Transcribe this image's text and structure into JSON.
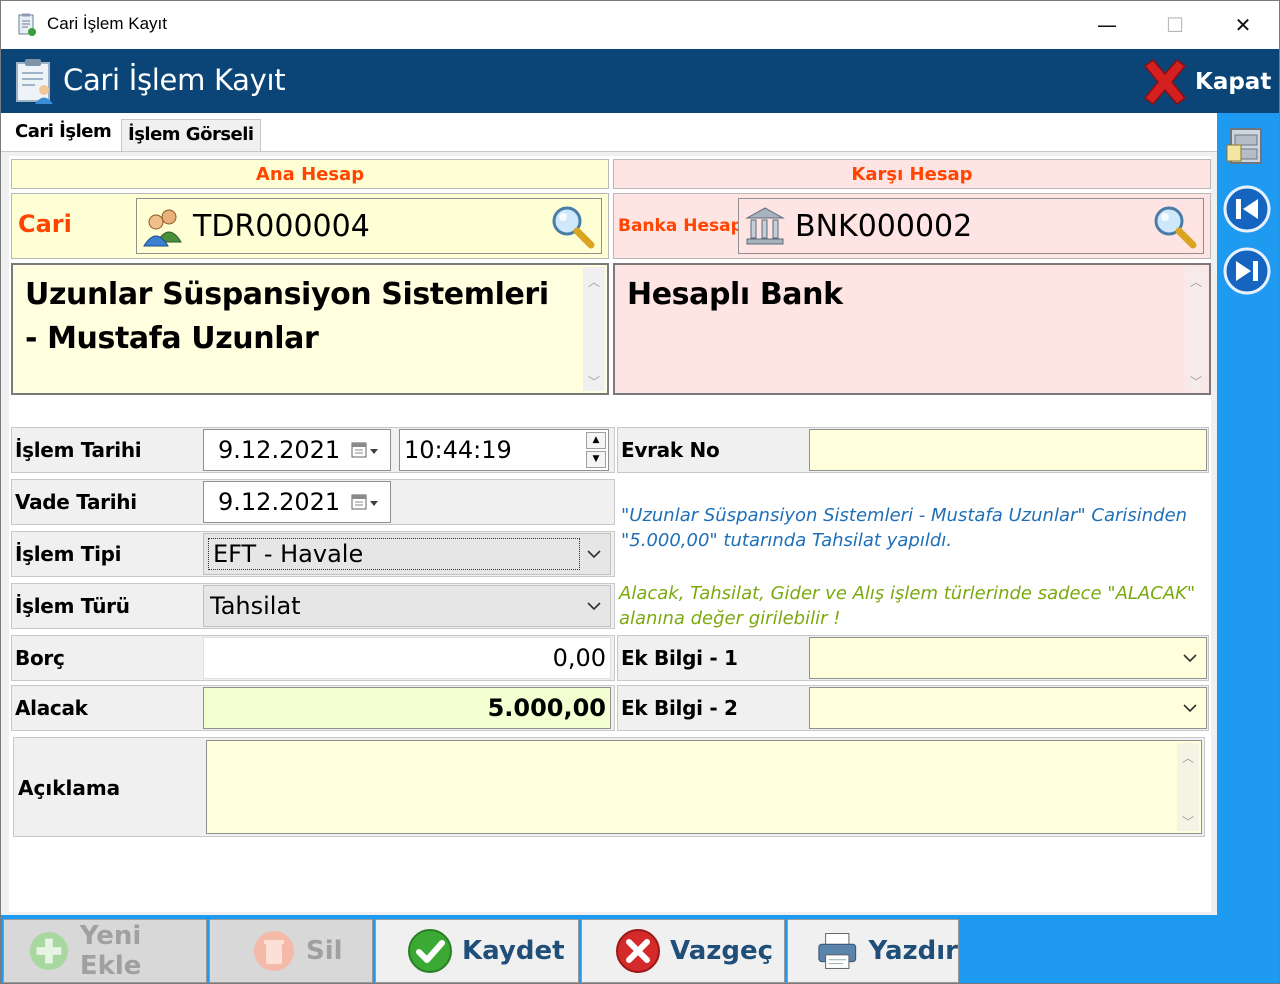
{
  "window": {
    "title": "Cari İşlem Kayıt",
    "controls": {
      "minimize": "—",
      "maximize": "☐",
      "close": "✕"
    }
  },
  "header": {
    "title": "Cari İşlem Kayıt",
    "close_label": "Kapat"
  },
  "tabs": [
    {
      "label": "Cari İşlem",
      "active": true
    },
    {
      "label": "İşlem Görseli",
      "active": false
    }
  ],
  "ana_hesap": {
    "heading": "Ana Hesap",
    "type_label": "Cari",
    "code": "TDR000004",
    "description": "Uzunlar Süspansiyon Sistemleri - Mustafa Uzunlar"
  },
  "karsi_hesap": {
    "heading": "Karşı Hesap",
    "type_label": "Banka Hesap",
    "code": "BNK000002",
    "description": "Hesaplı Bank"
  },
  "form": {
    "islem_tarihi_label": "İşlem Tarihi",
    "islem_tarihi": "9.12.2021",
    "islem_saati": "10:44:19",
    "vade_tarihi_label": "Vade Tarihi",
    "vade_tarihi": "9.12.2021",
    "islem_tipi_label": "İşlem Tipi",
    "islem_tipi": "EFT - Havale",
    "islem_turu_label": "İşlem Türü",
    "islem_turu": "Tahsilat",
    "borc_label": "Borç",
    "borc": "0,00",
    "alacak_label": "Alacak",
    "alacak": "5.000,00",
    "evrak_no_label": "Evrak No",
    "evrak_no": "",
    "ek_bilgi_1_label": "Ek Bilgi - 1",
    "ek_bilgi_1": "",
    "ek_bilgi_2_label": "Ek Bilgi - 2",
    "ek_bilgi_2": "",
    "aciklama_label": "Açıklama",
    "aciklama": ""
  },
  "messages": {
    "summary": "\"Uzunlar Süspansiyon Sistemleri - Mustafa Uzunlar\" Carisinden \"5.000,00\" tutarında Tahsilat yapıldı.",
    "hint": "Alacak, Tahsilat, Gider ve Alış işlem türlerinde sadece \"ALACAK\" alanına değer girilebilir !"
  },
  "toolbar": {
    "new_label": "Yeni Ekle",
    "delete_label": "Sil",
    "save_label": "Kaydet",
    "cancel_label": "Vazgeç",
    "print_label": "Yazdır"
  },
  "colors": {
    "header_blue": "#0b4577",
    "side_blue": "#1e9af0",
    "accent_orange": "#ff4500",
    "yellow_field": "#ffffd6",
    "pink_field": "#ffe4e4",
    "info_blue": "#1f6fb8",
    "info_green": "#7ba90f"
  }
}
